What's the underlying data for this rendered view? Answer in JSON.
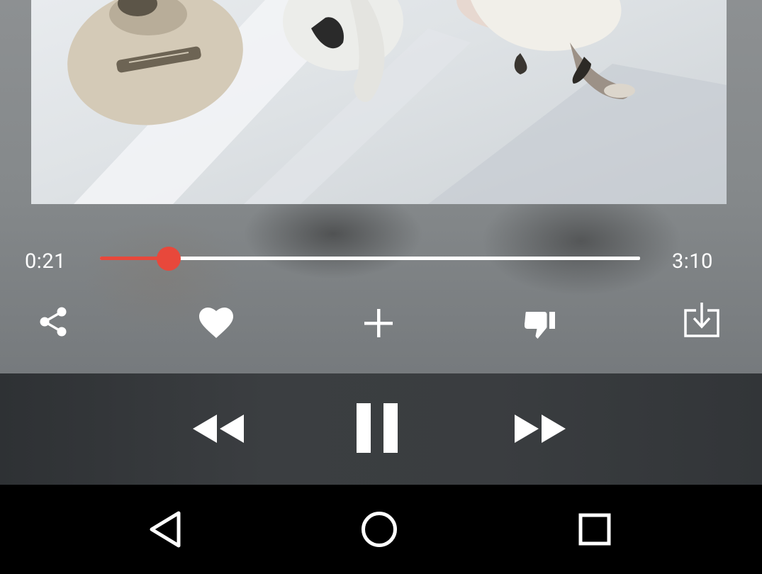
{
  "player": {
    "elapsed": "0:21",
    "total": "3:10",
    "progress_fraction": 0.127,
    "accent_color": "#e8483b"
  },
  "actions": [
    {
      "icon": "share-icon"
    },
    {
      "icon": "heart-icon"
    },
    {
      "icon": "plus-icon"
    },
    {
      "icon": "thumbs-down-icon"
    },
    {
      "icon": "download-icon"
    }
  ],
  "transport": {
    "prev_icon": "rewind-icon",
    "play_icon": "pause-icon",
    "next_icon": "fast-forward-icon"
  },
  "navbar": {
    "back_icon": "nav-back-icon",
    "home_icon": "nav-home-icon",
    "recents_icon": "nav-recents-icon"
  }
}
